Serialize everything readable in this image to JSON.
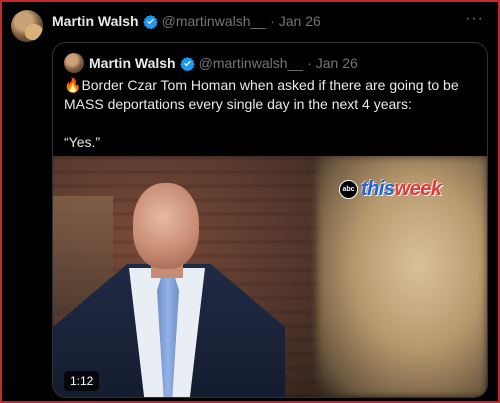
{
  "tweet": {
    "author_name": "Martin Walsh",
    "handle": "@martinwalsh__",
    "separator": "·",
    "date": "Jan 26",
    "more_label": "···"
  },
  "quoted": {
    "author_name": "Martin Walsh",
    "handle": "@martinwalsh__",
    "separator": "·",
    "date": "Jan 26",
    "emoji": "🔥",
    "text_line": "Border Czar Tom Homan when asked if there are going to be MASS deportations every single day in the next 4 years:",
    "text_quote": "“Yes.”",
    "video": {
      "duration": "1:12",
      "network_logo": "abc",
      "show_title_this": "this",
      "show_title_week": "week"
    }
  },
  "icons": {
    "verified": "verified-badge-icon",
    "more": "more-options-icon"
  },
  "colors": {
    "background": "#000000",
    "text": "#e7e9ea",
    "muted": "#71767b",
    "verified": "#1d9bf0",
    "border": "#2f3336",
    "frame": "#c62828"
  }
}
